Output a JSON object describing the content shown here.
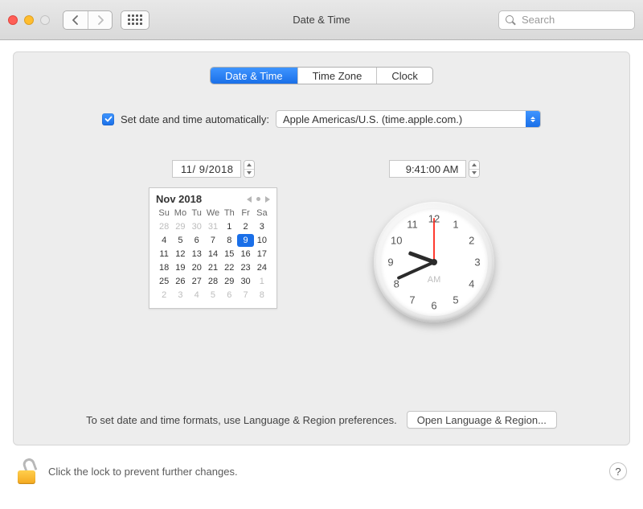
{
  "window": {
    "title": "Date & Time"
  },
  "search": {
    "placeholder": "Search"
  },
  "tabs": [
    {
      "label": "Date & Time",
      "active": true
    },
    {
      "label": "Time Zone",
      "active": false
    },
    {
      "label": "Clock",
      "active": false
    }
  ],
  "auto": {
    "checked": true,
    "label": "Set date and time automatically:",
    "server": "Apple Americas/U.S. (time.apple.com.)"
  },
  "date_field": "11/  9/2018",
  "time_field": "9:41:00 AM",
  "calendar": {
    "month_label": "Nov 2018",
    "day_headers": [
      "Su",
      "Mo",
      "Tu",
      "We",
      "Th",
      "Fr",
      "Sa"
    ],
    "weeks": [
      [
        {
          "n": 28,
          "dim": true
        },
        {
          "n": 29,
          "dim": true
        },
        {
          "n": 30,
          "dim": true
        },
        {
          "n": 31,
          "dim": true
        },
        {
          "n": 1
        },
        {
          "n": 2
        },
        {
          "n": 3
        }
      ],
      [
        {
          "n": 4
        },
        {
          "n": 5
        },
        {
          "n": 6
        },
        {
          "n": 7
        },
        {
          "n": 8
        },
        {
          "n": 9,
          "sel": true
        },
        {
          "n": 10
        }
      ],
      [
        {
          "n": 11
        },
        {
          "n": 12
        },
        {
          "n": 13
        },
        {
          "n": 14
        },
        {
          "n": 15
        },
        {
          "n": 16
        },
        {
          "n": 17
        }
      ],
      [
        {
          "n": 18
        },
        {
          "n": 19
        },
        {
          "n": 20
        },
        {
          "n": 21
        },
        {
          "n": 22
        },
        {
          "n": 23
        },
        {
          "n": 24
        }
      ],
      [
        {
          "n": 25
        },
        {
          "n": 26
        },
        {
          "n": 27
        },
        {
          "n": 28
        },
        {
          "n": 29
        },
        {
          "n": 30
        },
        {
          "n": 1,
          "dim": true
        }
      ],
      [
        {
          "n": 2,
          "dim": true
        },
        {
          "n": 3,
          "dim": true
        },
        {
          "n": 4,
          "dim": true
        },
        {
          "n": 5,
          "dim": true
        },
        {
          "n": 6,
          "dim": true
        },
        {
          "n": 7,
          "dim": true
        },
        {
          "n": 8,
          "dim": true
        }
      ]
    ]
  },
  "clock": {
    "ampm": "AM",
    "hour_angle": 290,
    "minute_angle": 246,
    "second_angle": 0,
    "numerals": [
      "12",
      "1",
      "2",
      "3",
      "4",
      "5",
      "6",
      "7",
      "8",
      "9",
      "10",
      "11"
    ]
  },
  "footer": {
    "hint": "To set date and time formats, use Language & Region preferences.",
    "button": "Open Language & Region..."
  },
  "lock": {
    "text": "Click the lock to prevent further changes."
  },
  "help": "?"
}
